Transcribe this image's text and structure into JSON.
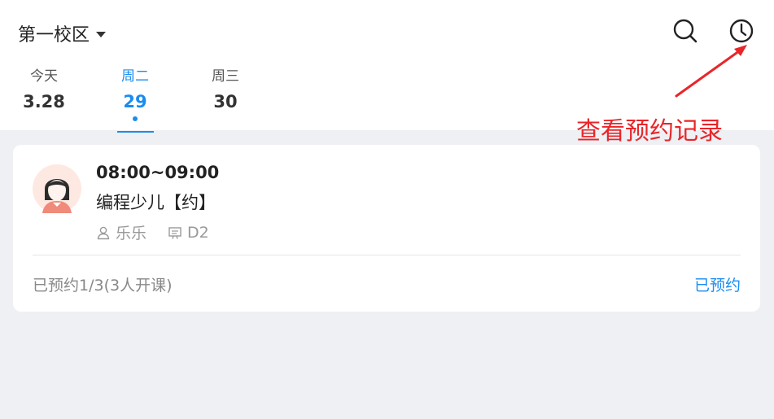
{
  "header": {
    "campus": "第一校区",
    "icons": {
      "search": "search-icon",
      "history": "clock-icon"
    }
  },
  "days": [
    {
      "weekday": "今天",
      "date": "3.28",
      "active": false
    },
    {
      "weekday": "周二",
      "date": "29",
      "active": true
    },
    {
      "weekday": "周三",
      "date": "30",
      "active": false
    }
  ],
  "annotation": {
    "text": "查看预约记录",
    "color": "#e8262a"
  },
  "class_card": {
    "time": "08:00~09:00",
    "course": "编程少儿【约】",
    "teacher": "乐乐",
    "room": "D2",
    "status": "已预约1/3(3人开课)",
    "action": "已预约"
  },
  "colors": {
    "accent": "#1a8cf0",
    "background": "#eef0f4"
  }
}
